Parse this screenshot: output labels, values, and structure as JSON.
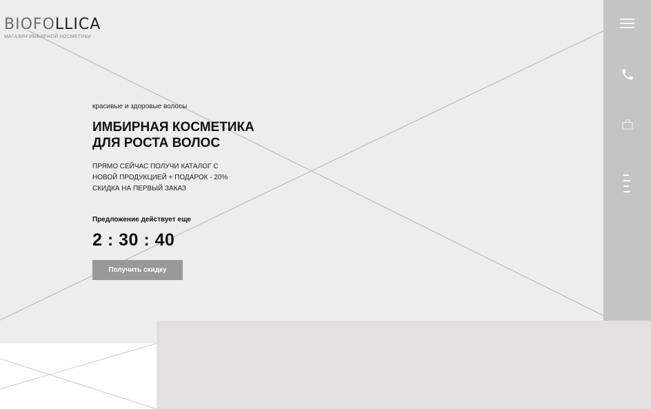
{
  "brand": {
    "logo_dark": "BIOFO",
    "logo_light": "LLICA",
    "tagline": "МАГАЗИН ИМБИРНОЙ КОСМЕТИКИ"
  },
  "hero": {
    "subtitle": "красивые и здоровые волосы",
    "headline_line1": "ИМБИРНАЯ КОСМЕТИКА",
    "headline_line2": "ДЛЯ РОСТА ВОЛОС",
    "offer": "ПРЯМО СЕЙЧАС ПОЛУЧИ КАТАЛОГ С НОВОЙ ПРОДУКЦИЕЙ + ПОДАРОК - 20% СКИДКА НА ПЕРВЫЙ ЗАКАЗ",
    "timer_label": "Предложение действует еще",
    "timer": "2 : 30 : 40",
    "cta_label": "Получить скидку"
  },
  "sidebar": {
    "icons": [
      "menu-icon",
      "phone-icon",
      "shopping-bag-icon",
      "page-nav-icon"
    ]
  },
  "colors": {
    "hero_bg": "#ededed",
    "sidebar_bg": "#c4c4c4",
    "cta_bg": "#999999",
    "lower_block_bg": "#e2e0e1"
  }
}
